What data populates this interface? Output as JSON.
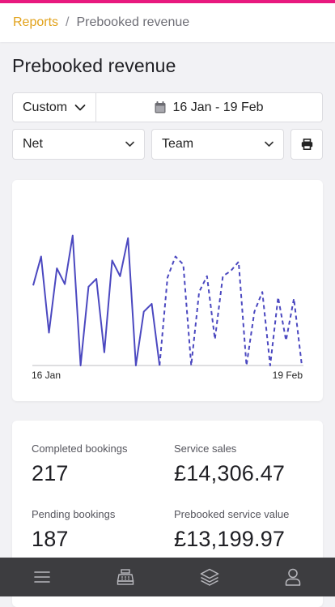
{
  "breadcrumb": {
    "parent": "Reports",
    "separator": "/",
    "current": "Prebooked revenue"
  },
  "page": {
    "title": "Prebooked revenue"
  },
  "filters": {
    "period": "Custom",
    "date_range": "16 Jan - 19 Feb",
    "measure": "Net",
    "group": "Team"
  },
  "chart_data": {
    "type": "line",
    "x_start_label": "16 Jan",
    "x_end_label": "19 Feb",
    "ylim": [
      0,
      100
    ],
    "series": [
      {
        "style": "solid",
        "color": "#4b48c0",
        "x_start": 0,
        "values": [
          61,
          83,
          25,
          74,
          62,
          99,
          0,
          60,
          66,
          10,
          80,
          68,
          97,
          0,
          41,
          47,
          0
        ]
      },
      {
        "style": "dashed",
        "color": "#4b48c0",
        "x_start": 16,
        "values": [
          0,
          67,
          83,
          77,
          0,
          56,
          68,
          20,
          68,
          72,
          79,
          0,
          41,
          56,
          0,
          52,
          19,
          51,
          0
        ]
      }
    ]
  },
  "stats": {
    "completed_bookings": {
      "label": "Completed bookings",
      "value": "217"
    },
    "service_sales": {
      "label": "Service sales",
      "value": "£14,306.47"
    },
    "pending_bookings": {
      "label": "Pending bookings",
      "value": "187"
    },
    "prebooked_service_value": {
      "label": "Prebooked service value",
      "value": "£13,199.97"
    }
  },
  "nav": {
    "items": [
      {
        "icon": "menu-icon"
      },
      {
        "icon": "register-icon"
      },
      {
        "icon": "layers-icon"
      },
      {
        "icon": "user-icon"
      }
    ]
  },
  "colors": {
    "accent": "#e8197f",
    "link": "#e2a21b",
    "series": "#4b48c0",
    "nav_bg": "#3d3d40"
  }
}
